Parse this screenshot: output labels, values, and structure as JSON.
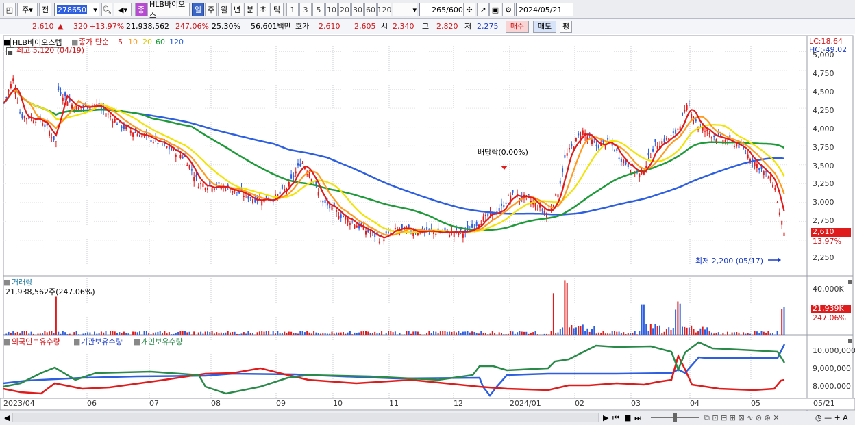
{
  "toolbar": {
    "period_type": "주",
    "prev_label": "전",
    "code_value": "278650",
    "stock_tag": "종",
    "stock_name": "HLB바이오스",
    "period_tabs": [
      "일",
      "주",
      "월",
      "년",
      "분",
      "초",
      "틱"
    ],
    "interval_buttons": [
      "1",
      "3",
      "5",
      "10",
      "20",
      "30",
      "60",
      "120"
    ],
    "view_count": "265",
    "view_total": "/600",
    "date_value": "2024/05/21"
  },
  "quote": {
    "price": "2,610",
    "up_mark": "▲",
    "change": "320",
    "change_pct": "+13.97%",
    "volume": "21,938,562",
    "volume_ratio": "247.06%",
    "turnover": "25.30%",
    "amount": "56,601백만",
    "bid_label": "호가",
    "bid1": "2,610",
    "bid2": "2,605",
    "open_label": "시",
    "open": "2,340",
    "high_label": "고",
    "high": "2,820",
    "low_label": "저",
    "low": "2,275",
    "buy_button": "매수",
    "sell_button": "매도",
    "eval_button": "평"
  },
  "price_panel": {
    "stock_label": "HLB바이오스텝",
    "ma_label": "종가 단순",
    "ma_periods": [
      "5",
      "10",
      "20",
      "60",
      "120"
    ],
    "ma_colors": [
      "#e01b1b",
      "#ff9a1f",
      "#f2e300",
      "#1e9a3a",
      "#2d5fe0"
    ],
    "high_note": "최고 5,120 (04/19)",
    "low_note": "최저 2,200 (05/17)",
    "dividend_note": "배당락(0.00%)",
    "lc": "LC:18.64",
    "hc": "HC:-49.02",
    "last_price_box": "2,610",
    "last_pct": "13.97%",
    "y_ticks": [
      "5,000",
      "4,750",
      "4,500",
      "4,250",
      "4,000",
      "3,750",
      "3,500",
      "3,250",
      "3,000",
      "2,750",
      "2,250"
    ]
  },
  "volume_panel": {
    "title": "거래량",
    "value_note": "21,938,562주(247.06%)",
    "y_tick": "40,000K",
    "last_box": "21,939K",
    "last_pct": "247.06%"
  },
  "holdings_panel": {
    "series_labels": [
      "외국인보유수량",
      "기관보유수량",
      "개인보유수량"
    ],
    "series_colors": [
      "#e01b1b",
      "#2d5fe0",
      "#2a8a4a"
    ],
    "y_ticks": [
      "10,000,000",
      "9,000,000",
      "8,000,000"
    ]
  },
  "x_axis": [
    "2023/04",
    "06",
    "07",
    "08",
    "09",
    "10",
    "11",
    "12",
    "2024/01",
    "02",
    "03",
    "04",
    "05",
    "05/21"
  ],
  "chart_data": {
    "type": "line",
    "title": "",
    "x": [
      "2023/04",
      "2023/06",
      "2023/07",
      "2023/08",
      "2023/09",
      "2023/10",
      "2023/11",
      "2023/12",
      "2024/01",
      "2024/02",
      "2024/03",
      "2024/04",
      "2024/05",
      "2024/05/21"
    ],
    "series": [
      {
        "name": "종가",
        "values": [
          4400,
          4100,
          3700,
          3150,
          3550,
          2800,
          2480,
          2570,
          3050,
          3950,
          3300,
          4100,
          3700,
          2610
        ]
      }
    ],
    "ylim": [
      2100,
      5050
    ]
  }
}
